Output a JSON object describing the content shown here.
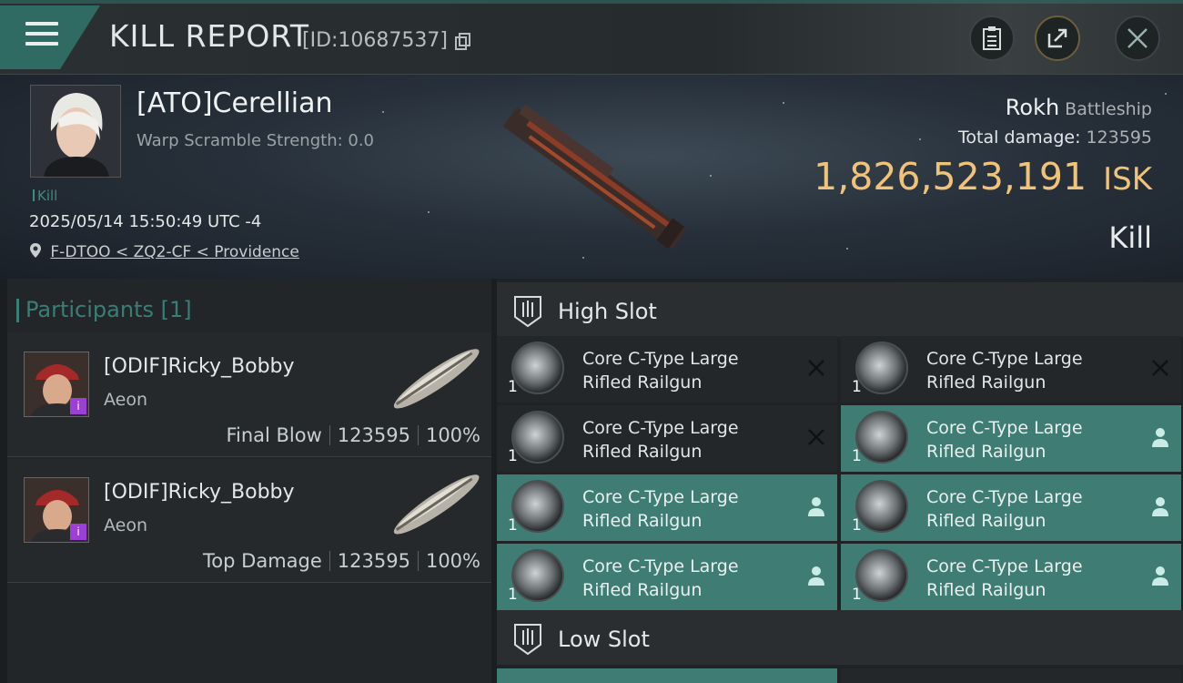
{
  "header": {
    "title": "KILL REPORT",
    "report_id": "[ID:10687537]",
    "icons": [
      "menu-icon",
      "copy-icon",
      "clipboard-icon",
      "share-icon",
      "close-icon"
    ]
  },
  "victim": {
    "name": "[ATO]Cerellian",
    "scramble": "Warp Scramble Strength: 0.0",
    "tag": "Kill",
    "timestamp": "2025/05/14 15:50:49 UTC -4",
    "location": "F-DTOO < ZQ2-CF < Providence",
    "ship": "Rokh",
    "ship_class": "Battleship",
    "total_damage_label": "Total damage:",
    "total_damage": "123595",
    "isk_value": "1,826,523,191",
    "isk_unit": "ISK",
    "outcome": "Kill"
  },
  "participants": {
    "header": "Participants [1]",
    "rows": [
      {
        "name": "[ODIF]Ricky_Bobby",
        "corp": "Aeon",
        "role": "Final Blow",
        "damage": "123595",
        "percent": "100%"
      },
      {
        "name": "[ODIF]Ricky_Bobby",
        "corp": "Aeon",
        "role": "Top Damage",
        "damage": "123595",
        "percent": "100%"
      }
    ]
  },
  "slots": {
    "high_title": "High Slot",
    "low_title": "Low Slot",
    "modules": [
      {
        "line1": "Core C-Type Large",
        "line2": "Rifled Railgun",
        "qty": "1",
        "state": "destroyed"
      },
      {
        "line1": "Core C-Type Large",
        "line2": "Rifled Railgun",
        "qty": "1",
        "state": "destroyed"
      },
      {
        "line1": "Core C-Type Large",
        "line2": "Rifled Railgun",
        "qty": "1",
        "state": "destroyed"
      },
      {
        "line1": "Core C-Type Large",
        "line2": "Rifled Railgun",
        "qty": "1",
        "state": "dropped"
      },
      {
        "line1": "Core C-Type Large",
        "line2": "Rifled Railgun",
        "qty": "1",
        "state": "dropped"
      },
      {
        "line1": "Core C-Type Large",
        "line2": "Rifled Railgun",
        "qty": "1",
        "state": "dropped"
      },
      {
        "line1": "Core C-Type Large",
        "line2": "Rifled Railgun",
        "qty": "1",
        "state": "dropped"
      },
      {
        "line1": "Core C-Type Large",
        "line2": "Rifled Railgun",
        "qty": "1",
        "state": "dropped"
      }
    ]
  },
  "colors": {
    "accent": "#3f7d74",
    "isk": "#f0c37b",
    "background": "#1b1e21"
  }
}
